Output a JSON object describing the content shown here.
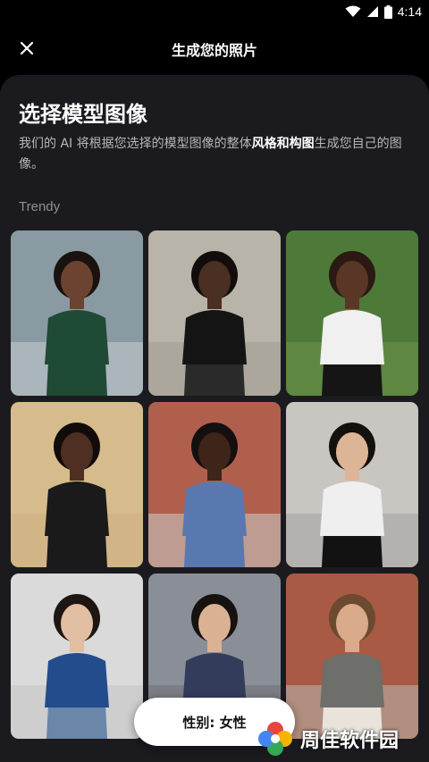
{
  "status_bar": {
    "time": "4:14",
    "icons": [
      "wifi-icon",
      "signal-icon",
      "battery-icon"
    ]
  },
  "header": {
    "title": "生成您的照片",
    "close_icon": "close-icon"
  },
  "main": {
    "title": "选择模型图像",
    "subtitle_before": "我们的 AI 将根据您选择的模型图像的整体",
    "subtitle_bold": "风格和构图",
    "subtitle_after": "生成您自己的图像。",
    "section_label": "Trendy"
  },
  "grid": {
    "tiles": [
      {
        "name": "model-photo-1",
        "bg": "#8a9aa3",
        "ground": "#bfc9cc",
        "skin": "#6b4330",
        "hair": "#1a120e",
        "top": "#1f4a35",
        "bottom": "#1f4a35"
      },
      {
        "name": "model-photo-2",
        "bg": "#b8b4a9",
        "ground": "#a29e94",
        "skin": "#4a2f22",
        "hair": "#120d0b",
        "top": "#141414",
        "bottom": "#2a2a2a"
      },
      {
        "name": "model-photo-3",
        "bg": "#4d7a38",
        "ground": "#6a8f4a",
        "skin": "#5a3626",
        "hair": "#2a1a12",
        "top": "#f0f0f0",
        "bottom": "#151515"
      },
      {
        "name": "model-photo-4",
        "bg": "#d6bb8c",
        "ground": "#cfb184",
        "skin": "#4e2f22",
        "hair": "#110c0a",
        "top": "#1a1a1a",
        "bottom": "#1a1a1a"
      },
      {
        "name": "model-photo-5",
        "bg": "#b05f4c",
        "ground": "#c8c4bf",
        "skin": "#3f2519",
        "hair": "#151010",
        "top": "#5a78b0",
        "bottom": "#5a78b0"
      },
      {
        "name": "model-photo-6",
        "bg": "#c9c6c2",
        "ground": "#a8a4a0",
        "skin": "#dcb597",
        "hair": "#14100e",
        "top": "#efefef",
        "bottom": "#121212"
      },
      {
        "name": "model-photo-7",
        "bg": "#dadada",
        "ground": "#c6c6c6",
        "skin": "#e2bea3",
        "hair": "#1d1612",
        "top": "#234c8c",
        "bottom": "#6a86a8"
      },
      {
        "name": "model-photo-8",
        "bg": "#8a8e96",
        "ground": "#6f7378",
        "skin": "#dab293",
        "hair": "#161210",
        "top": "#343c5c",
        "bottom": "#343c5c"
      },
      {
        "name": "model-photo-9",
        "bg": "#a85a44",
        "ground": "#b8b0a8",
        "skin": "#d9ab8a",
        "hair": "#6b4a30",
        "top": "#6e6e6a",
        "bottom": "#e8e4dc"
      }
    ]
  },
  "gender_selector": {
    "label": "性别: 女性"
  },
  "watermark": {
    "text": "周佳软件园"
  }
}
